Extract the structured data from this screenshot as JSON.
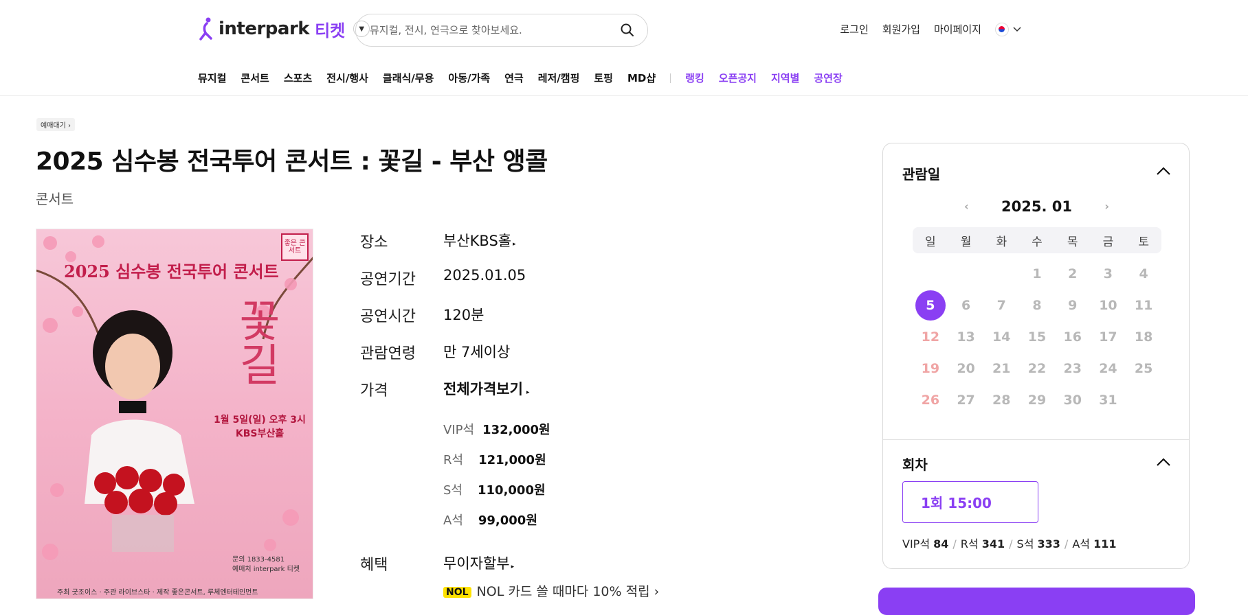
{
  "header": {
    "brand": "interpark",
    "brand_sub": "티켓",
    "search_placeholder": "뮤지컬, 전시, 연극으로 찾아보세요.",
    "util_links": [
      "로그인",
      "회원가입",
      "마이페이지"
    ]
  },
  "nav": {
    "items": [
      "뮤지컬",
      "콘서트",
      "스포츠",
      "전시/행사",
      "클래식/무용",
      "아동/가족",
      "연극",
      "레저/캠핑",
      "토핑",
      "MD샵"
    ],
    "purple_items": [
      "랭킹",
      "오픈공지",
      "지역별",
      "공연장"
    ],
    "accent_color": "#8a3ff3"
  },
  "product": {
    "badge": "예매대기",
    "title": "2025 심수봉 전국투어 콘서트 : 꽃길 - 부산 앵콜",
    "genre": "콘서트",
    "poster": {
      "title": "2025 심수봉 전국투어 콘서트",
      "big": "꽃길",
      "when_line1": "1월 5일(일) 오후 3시",
      "when_line2": "KBS부산홀",
      "stamp": "좋은 콘서트",
      "contact": "문의 1833-4581",
      "seller": "예매처 interpark 티켓",
      "footer": "주최 굿조이스 · 주관 라이브스타 · 제작 좋은콘서트, 루체엔터테인먼트"
    },
    "info": {
      "venue_label": "장소",
      "venue": "부산KBS홀",
      "period_label": "공연기간",
      "period": "2025.01.05",
      "runtime_label": "공연시간",
      "runtime": "120분",
      "age_label": "관람연령",
      "age": "만 7세이상",
      "price_label": "가격",
      "price_all": "전체가격보기",
      "prices": [
        {
          "grade": "VIP석",
          "price": "132,000원"
        },
        {
          "grade": "R석",
          "price": "121,000원"
        },
        {
          "grade": "S석",
          "price": "110,000원"
        },
        {
          "grade": "A석",
          "price": "99,000원"
        }
      ],
      "benefit_label": "혜택",
      "benefit": "무이자할부",
      "nol_logo": "NOL",
      "nol_text": "NOL 카드 쓸 때마다 10% 적립"
    }
  },
  "booking": {
    "date_label": "관람일",
    "month": "2025. 01",
    "weekdays": [
      "일",
      "월",
      "화",
      "수",
      "목",
      "금",
      "토"
    ],
    "selected_day": "5",
    "session_label": "회차",
    "session": "1회  15:00",
    "seats": [
      {
        "grade": "VIP석",
        "count": "84"
      },
      {
        "grade": "R석",
        "count": "341"
      },
      {
        "grade": "S석",
        "count": "333"
      },
      {
        "grade": "A석",
        "count": "111"
      }
    ]
  }
}
